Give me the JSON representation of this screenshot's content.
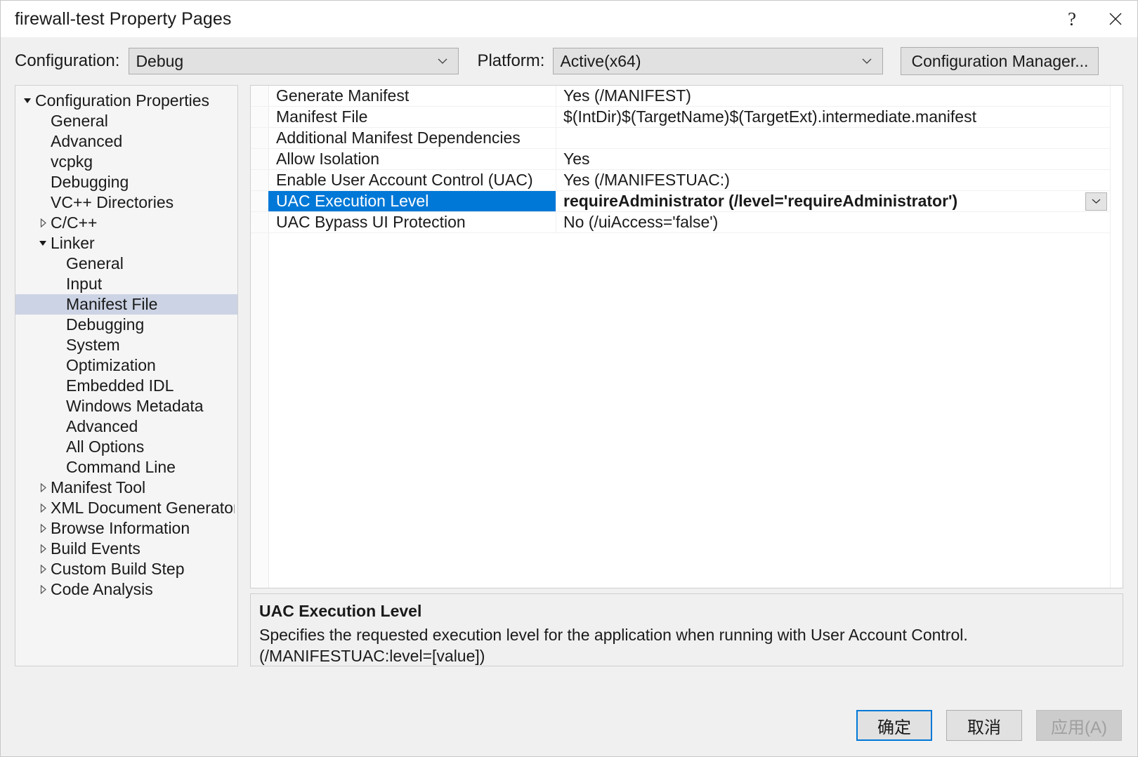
{
  "window": {
    "title": "firewall-test Property Pages",
    "help_icon": "?",
    "close_icon": "close-icon"
  },
  "toolbar": {
    "configuration_label": "Configuration:",
    "configuration_value": "Debug",
    "platform_label": "Platform:",
    "platform_value": "Active(x64)",
    "configuration_manager_label": "Configuration Manager..."
  },
  "tree": {
    "items": [
      {
        "label": "Configuration Properties",
        "level": 0,
        "arrow": "expanded",
        "selected": false
      },
      {
        "label": "General",
        "level": 1,
        "arrow": "none",
        "selected": false
      },
      {
        "label": "Advanced",
        "level": 1,
        "arrow": "none",
        "selected": false
      },
      {
        "label": "vcpkg",
        "level": 1,
        "arrow": "none",
        "selected": false
      },
      {
        "label": "Debugging",
        "level": 1,
        "arrow": "none",
        "selected": false
      },
      {
        "label": "VC++ Directories",
        "level": 1,
        "arrow": "none",
        "selected": false
      },
      {
        "label": "C/C++",
        "level": 0,
        "arrow": "collapsed",
        "selected": false,
        "indent": 1
      },
      {
        "label": "Linker",
        "level": 0,
        "arrow": "expanded",
        "selected": false,
        "indent": 1
      },
      {
        "label": "General",
        "level": 2,
        "arrow": "none",
        "selected": false
      },
      {
        "label": "Input",
        "level": 2,
        "arrow": "none",
        "selected": false
      },
      {
        "label": "Manifest File",
        "level": 2,
        "arrow": "none",
        "selected": true
      },
      {
        "label": "Debugging",
        "level": 2,
        "arrow": "none",
        "selected": false
      },
      {
        "label": "System",
        "level": 2,
        "arrow": "none",
        "selected": false
      },
      {
        "label": "Optimization",
        "level": 2,
        "arrow": "none",
        "selected": false
      },
      {
        "label": "Embedded IDL",
        "level": 2,
        "arrow": "none",
        "selected": false
      },
      {
        "label": "Windows Metadata",
        "level": 2,
        "arrow": "none",
        "selected": false
      },
      {
        "label": "Advanced",
        "level": 2,
        "arrow": "none",
        "selected": false
      },
      {
        "label": "All Options",
        "level": 2,
        "arrow": "none",
        "selected": false
      },
      {
        "label": "Command Line",
        "level": 2,
        "arrow": "none",
        "selected": false
      },
      {
        "label": "Manifest Tool",
        "level": 0,
        "arrow": "collapsed",
        "selected": false,
        "indent": 1
      },
      {
        "label": "XML Document Generator",
        "level": 0,
        "arrow": "collapsed",
        "selected": false,
        "indent": 1
      },
      {
        "label": "Browse Information",
        "level": 0,
        "arrow": "collapsed",
        "selected": false,
        "indent": 1
      },
      {
        "label": "Build Events",
        "level": 0,
        "arrow": "collapsed",
        "selected": false,
        "indent": 1
      },
      {
        "label": "Custom Build Step",
        "level": 0,
        "arrow": "collapsed",
        "selected": false,
        "indent": 1
      },
      {
        "label": "Code Analysis",
        "level": 0,
        "arrow": "collapsed",
        "selected": false,
        "indent": 1
      }
    ]
  },
  "grid": {
    "rows": [
      {
        "name": "Generate Manifest",
        "value": "Yes (/MANIFEST)",
        "selected": false
      },
      {
        "name": "Manifest File",
        "value": "$(IntDir)$(TargetName)$(TargetExt).intermediate.manifest",
        "selected": false
      },
      {
        "name": "Additional Manifest Dependencies",
        "value": "",
        "selected": false
      },
      {
        "name": "Allow Isolation",
        "value": "Yes",
        "selected": false
      },
      {
        "name": "Enable User Account Control (UAC)",
        "value": "Yes (/MANIFESTUAC:)",
        "selected": false
      },
      {
        "name": "UAC Execution Level",
        "value": "requireAdministrator (/level='requireAdministrator')",
        "selected": true
      },
      {
        "name": "UAC Bypass UI Protection",
        "value": "No (/uiAccess='false')",
        "selected": false
      }
    ]
  },
  "description": {
    "title": "UAC Execution Level",
    "line1": "Specifies the requested execution level for the application when running with User Account Control.",
    "line2": "(/MANIFESTUAC:level=[value])"
  },
  "footer": {
    "ok_label": "确定",
    "cancel_label": "取消",
    "apply_label": "应用(A)"
  },
  "colors": {
    "selection_blue": "#0078d7",
    "tree_selection": "#cbd3e4",
    "dialog_bg": "#f0f0f0"
  }
}
